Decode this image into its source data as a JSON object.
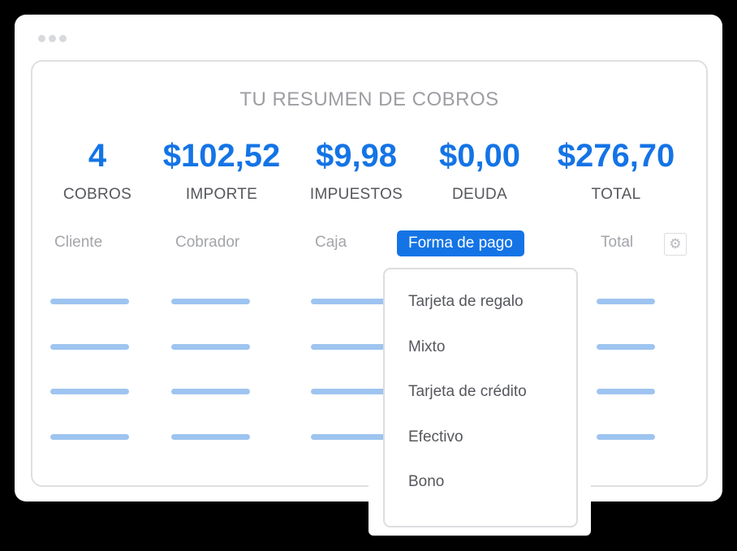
{
  "title": "TU RESUMEN DE COBROS",
  "stats": [
    {
      "value": "4",
      "label": "COBROS"
    },
    {
      "value": "$102,52",
      "label": "IMPORTE"
    },
    {
      "value": "$9,98",
      "label": "IMPUESTOS"
    },
    {
      "value": "$0,00",
      "label": "DEUDA"
    },
    {
      "value": "$276,70",
      "label": "TOTAL"
    }
  ],
  "columns": [
    "Cliente",
    "Cobrador",
    "Caja",
    "Forma de pago",
    "Total"
  ],
  "active_column": "Forma de pago",
  "dropdown": {
    "options": [
      "Tarjeta de regalo",
      "Mixto",
      "Tarjeta de crédito",
      "Efectivo",
      "Bono"
    ]
  },
  "icons": {
    "settings": "gear-icon"
  },
  "colors": {
    "accent": "#1474e6",
    "placeholder_bar": "#9ec4f0"
  }
}
